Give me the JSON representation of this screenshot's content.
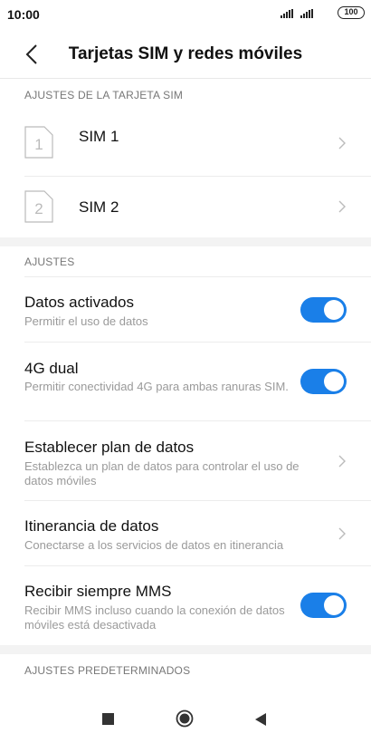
{
  "status_bar": {
    "time": "10:00",
    "battery": "100"
  },
  "header": {
    "title": "Tarjetas SIM y redes móviles"
  },
  "sim_section": {
    "header": "AJUSTES DE LA TARJETA SIM",
    "items": [
      {
        "label": "SIM 1",
        "icon_text": "1"
      },
      {
        "label": "SIM 2",
        "icon_text": "2"
      }
    ]
  },
  "settings_section": {
    "header": "AJUSTES",
    "items": [
      {
        "title": "Datos activados",
        "subtitle": "Permitir el uso de datos",
        "control": "toggle",
        "on": true
      },
      {
        "title": "4G dual",
        "subtitle": "Permitir conectividad 4G para ambas ranuras SIM.",
        "control": "toggle",
        "on": true
      },
      {
        "title": "Establecer plan de datos",
        "subtitle": "Establezca un plan de datos para controlar el uso de datos móviles",
        "control": "chevron"
      },
      {
        "title": "Itinerancia de datos",
        "subtitle": "Conectarse a los servicios de datos en itinerancia",
        "control": "chevron"
      },
      {
        "title": "Recibir siempre MMS",
        "subtitle": "Recibir MMS incluso cuando la conexión de datos móviles está desactivada",
        "control": "toggle",
        "on": true
      }
    ]
  },
  "defaults_section": {
    "header": "AJUSTES PREDETERMINADOS"
  },
  "colors": {
    "accent": "#1a7fe8",
    "section_bg": "#f3f3f3",
    "subtitle": "#9a9a9a"
  },
  "nav_bar": {
    "icons": [
      "recents-square-icon",
      "home-circle-icon",
      "back-triangle-icon"
    ]
  }
}
